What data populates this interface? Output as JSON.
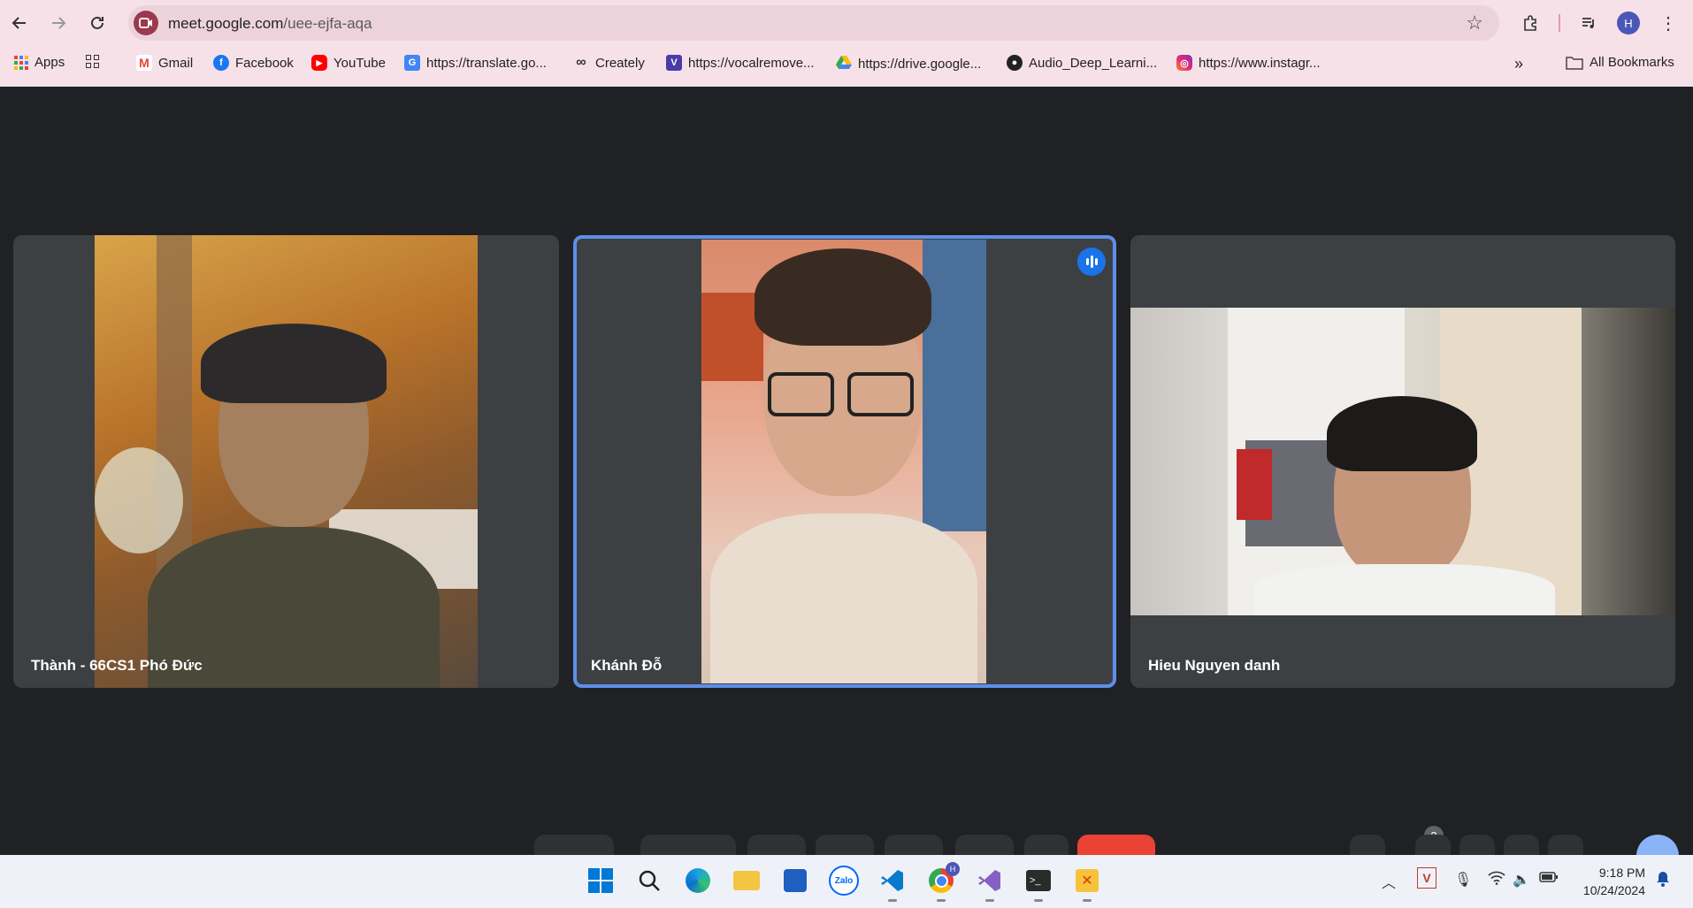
{
  "browser": {
    "url_host": "meet.google.com",
    "url_path": "/uee-ejfa-aqa",
    "profile_initial": "H",
    "bookmarks": [
      {
        "label": "Apps",
        "icon": "apps-grid-icon"
      },
      {
        "label": "",
        "icon": "tab-groups-icon"
      },
      {
        "label": "Gmail",
        "icon": "gmail-icon"
      },
      {
        "label": "Facebook",
        "icon": "facebook-icon"
      },
      {
        "label": "YouTube",
        "icon": "youtube-icon"
      },
      {
        "label": "https://translate.go...",
        "icon": "translate-icon"
      },
      {
        "label": "Creately",
        "icon": "creately-icon"
      },
      {
        "label": "https://vocalremove...",
        "icon": "vocalremover-icon"
      },
      {
        "label": "https://drive.google...",
        "icon": "drive-icon"
      },
      {
        "label": "Audio_Deep_Learni...",
        "icon": "github-icon"
      },
      {
        "label": "https://www.instagr...",
        "icon": "instagram-icon"
      }
    ],
    "all_bookmarks": "All Bookmarks"
  },
  "meeting": {
    "participants": [
      {
        "name": "Thành - 66CS1 Phó Đức",
        "active_speaker": false
      },
      {
        "name": "Khánh Đỗ",
        "active_speaker": true
      },
      {
        "name": "Hieu Nguyen danh",
        "active_speaker": false
      }
    ],
    "participant_count": "3"
  },
  "taskbar": {
    "time": "9:18 PM",
    "date": "10/24/2024",
    "chrome_badge": "H"
  },
  "colors": {
    "chrome_bg": "#f7e1e8",
    "meet_bg": "#202124",
    "tile_bg": "#3c4043",
    "active_border": "#5e8ee8",
    "end_call": "#ea4335"
  }
}
